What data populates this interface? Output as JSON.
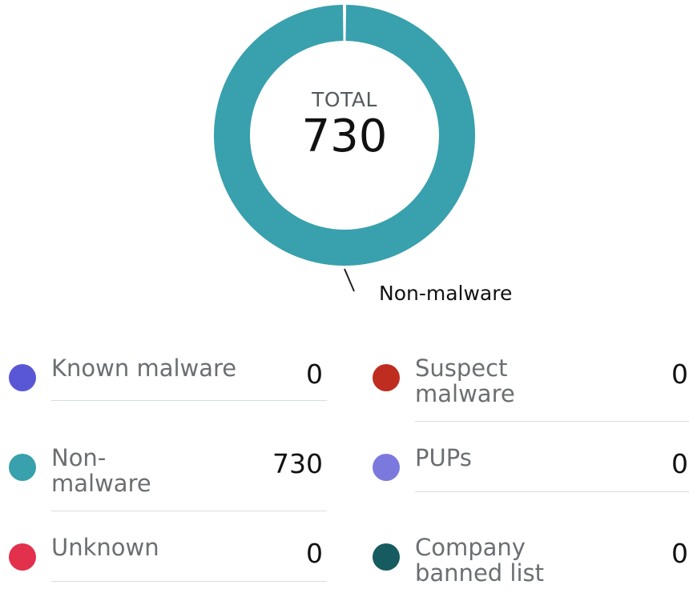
{
  "chart_data": {
    "type": "pie",
    "center_title": "TOTAL",
    "total": "730",
    "callout": "Non-malware",
    "categories": [
      "Known malware",
      "Non-malware",
      "Unknown",
      "Suspect malware",
      "PUPs",
      "Company banned list"
    ],
    "values": [
      0,
      730,
      0,
      0,
      0,
      0
    ],
    "value_labels": [
      "0",
      "730",
      "0",
      "0",
      "0",
      "0"
    ],
    "colors": [
      "#5a57d7",
      "#39a0ad",
      "#e3304d",
      "#be2d1f",
      "#7c79de",
      "#165b60"
    ]
  }
}
